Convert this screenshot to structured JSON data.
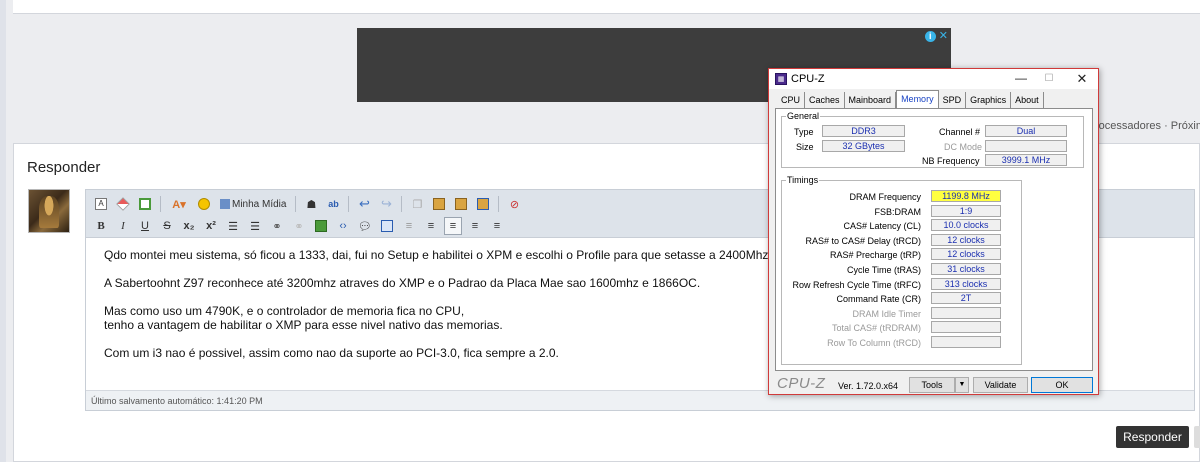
{
  "forum": {
    "breadcrumb": "rocessadores · Próxim",
    "reply_title": "Responder",
    "reply_button": "Responder",
    "autosave": "Último salvamento automático: 1:41:20 PM",
    "toolbar": {
      "media_label": "Minha Mídia",
      "bold": "B",
      "italic": "I",
      "underline": "U",
      "strike": "S",
      "subscript": "x₂",
      "superscript": "x²"
    },
    "editor_paragraphs": [
      [
        "Qdo montei meu sistema, só ficou a 1333, dai, fui no Setup e habilitei o XPM e escolhi o Profile para que setasse a 2400Mhz."
      ],
      [
        "A Sabertoohnt Z97 reconhece até 3200mhz atraves do XMP e o Padrao da Placa Mae sao 1600mhz e 1866OC."
      ],
      [
        "Mas como uso um 4790K, e o controlador de memoria fica no CPU,",
        "tenho a vantagem de habilitar o XMP para esse nivel nativo das memorias."
      ],
      [
        "Com um i3 nao é possivel, assim como nao da suporte ao PCI-3.0, fica sempre a 2.0."
      ]
    ]
  },
  "cpuz": {
    "title": "CPU-Z",
    "tabs": [
      "CPU",
      "Caches",
      "Mainboard",
      "Memory",
      "SPD",
      "Graphics",
      "About"
    ],
    "active_tab": "Memory",
    "general": {
      "title": "General",
      "type_label": "Type",
      "type_value": "DDR3",
      "size_label": "Size",
      "size_value": "32 GBytes",
      "channel_label": "Channel #",
      "channel_value": "Dual",
      "dc_mode_label": "DC Mode",
      "dc_mode_value": "",
      "nb_freq_label": "NB Frequency",
      "nb_freq_value": "3999.1 MHz"
    },
    "timings": {
      "title": "Timings",
      "rows": [
        {
          "label": "DRAM Frequency",
          "value": "1199.8 MHz",
          "highlight": true,
          "disabled": false
        },
        {
          "label": "FSB:DRAM",
          "value": "1:9",
          "highlight": false,
          "disabled": false
        },
        {
          "label": "CAS# Latency (CL)",
          "value": "10.0 clocks",
          "highlight": false,
          "disabled": false
        },
        {
          "label": "RAS# to CAS# Delay (tRCD)",
          "value": "12 clocks",
          "highlight": false,
          "disabled": false
        },
        {
          "label": "RAS# Precharge (tRP)",
          "value": "12 clocks",
          "highlight": false,
          "disabled": false
        },
        {
          "label": "Cycle Time (tRAS)",
          "value": "31 clocks",
          "highlight": false,
          "disabled": false
        },
        {
          "label": "Row Refresh Cycle Time (tRFC)",
          "value": "313 clocks",
          "highlight": false,
          "disabled": false
        },
        {
          "label": "Command Rate (CR)",
          "value": "2T",
          "highlight": false,
          "disabled": false
        },
        {
          "label": "DRAM Idle Timer",
          "value": "",
          "highlight": false,
          "disabled": true
        },
        {
          "label": "Total CAS# (tRDRAM)",
          "value": "",
          "highlight": false,
          "disabled": true
        },
        {
          "label": "Row To Column (tRCD)",
          "value": "",
          "highlight": false,
          "disabled": true
        }
      ]
    },
    "brand": "CPU-Z",
    "version": "Ver. 1.72.0.x64",
    "tools_label": "Tools",
    "validate_label": "Validate",
    "ok_label": "OK"
  }
}
